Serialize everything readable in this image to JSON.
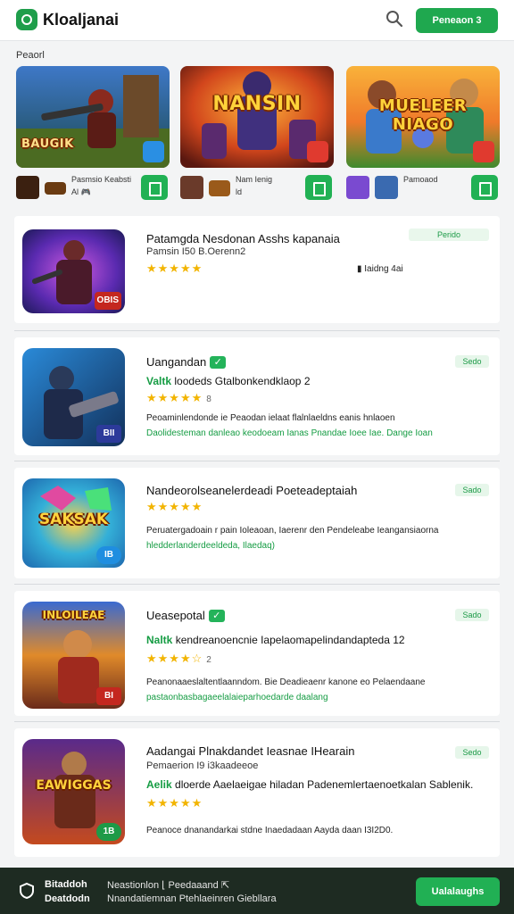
{
  "header": {
    "title": "Kloaljanai",
    "button_label": "Peneaon 3"
  },
  "featured": {
    "label": "Peaorl",
    "cards": [
      {
        "art_title": "BAUGIK",
        "subtitle": "Pasmsio Keabsti",
        "meta": "Al 🎮",
        "badge_color": "#2a8fe3"
      },
      {
        "art_title": "NANSIN",
        "subtitle": "Nam Ienig",
        "meta": "ld",
        "badge_color": "#e03a2f"
      },
      {
        "art_title": "MUELEER NIAGO",
        "subtitle": "Pamoaod",
        "meta": "",
        "badge_color": "#e03a2f"
      }
    ]
  },
  "list": [
    {
      "name": "Patamgda Nesdonan Asshs kapanaia",
      "line": "Pamsin I50 B.Oerenn2",
      "stars": "★★★★★",
      "rating": "",
      "installs": "Iaidng 4ai",
      "pill": "Perido",
      "art": "",
      "corner": "OBIS",
      "corner_color": "#c4271f",
      "desc1": "",
      "desc2": ""
    },
    {
      "name": "Uangandan",
      "line_green": "Valtk",
      "line": "loodeds Gtalbonkendklaop 2",
      "stars": "★★★★★",
      "rating": "8",
      "pill": "Sedo",
      "art": "",
      "corner": "BII",
      "corner_color": "#2c3a9a",
      "desc1": "Peoaminlendonde ie Peaodan ielaat flalnlaeldns eanis hnlaoen",
      "desc2": "Daolidesteman danleao keodoeam Ianas Pnandae Ioee Iae. Dange Ioan"
    },
    {
      "name": "Nandeorolseanelerdeadi Poeteadeptaiah",
      "stars": "★★★★★",
      "rating": "",
      "pill": "Sado",
      "art": "SAKSAK",
      "corner": "IB",
      "corner_color": "#1f8ee0",
      "desc1": "Peruatergadoain r pain Ioleaoan, Iaerenr den Pendeleabe Ieangansiaorna",
      "desc2": "hledderlanderdeeldeda, Ilaedaq)"
    },
    {
      "name": "Ueasepotal",
      "line_green": "Naltk",
      "line": "kendreanoencnie Iapelaomapelindandapteda 12",
      "stars": "★★★★☆",
      "rating": "2",
      "pill": "Sado",
      "art": "INLOILEAE",
      "corner": "BI",
      "corner_color": "#c4271f",
      "desc1": "Peanonaaeslaltentlaanndom. Bie Deadieaenr kanone eo Pelaendaane",
      "desc2": "pastaonbasbagaeelalaieparhoedarde daalang"
    },
    {
      "name": "Aadangai Plnakdandet Ieasnae IHearain",
      "line0": "Pemaerion I9 i3kaadeeoe",
      "line_green": "Aelik",
      "line": "dloerde Aaelaeigae hiladan Padenemlertaenoetkalan Sablenik.",
      "stars": "★★★★★",
      "rating": "",
      "pill": "Sedo",
      "art": "EAWIGGAS",
      "corner": "1B",
      "corner_color": "#1e9a47",
      "desc1": "Peanoce dnanandarkai stdne Inaedadaan Aayda daan I3I2D0."
    }
  ],
  "bottom_bar": {
    "line1": "Bitaddoh",
    "line2": "Deatdodn",
    "mid1": "Neastionlon ⌊ Peedaaand ⇱",
    "mid2": "Nnandatiemnan Ptehlaeinren Giebllara",
    "button_label": "Ualalaughs"
  },
  "colors": {
    "accent": "#1fa84f",
    "bottom_bar": "#1e2b22"
  }
}
